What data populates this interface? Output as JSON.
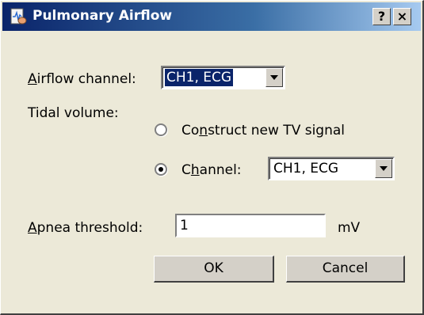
{
  "window": {
    "title": "Pulmonary Airflow",
    "help_button": "?",
    "close_button": "×"
  },
  "airflow": {
    "label_prefix": "",
    "label_mnemonic": "A",
    "label_rest": "irflow channel:",
    "selected": "CH1, ECG"
  },
  "tidal": {
    "label": "Tidal volume:",
    "option_construct": {
      "prefix": "Co",
      "mnemonic": "n",
      "rest": "struct new TV signal",
      "checked": false
    },
    "option_channel": {
      "prefix": "C",
      "mnemonic": "h",
      "rest": "annel:",
      "checked": true
    },
    "channel_selected": "CH1, ECG"
  },
  "apnea": {
    "label_mnemonic": "A",
    "label_rest": "pnea threshold:",
    "value": "1",
    "unit": "mV"
  },
  "buttons": {
    "ok": "OK",
    "cancel": "Cancel"
  }
}
